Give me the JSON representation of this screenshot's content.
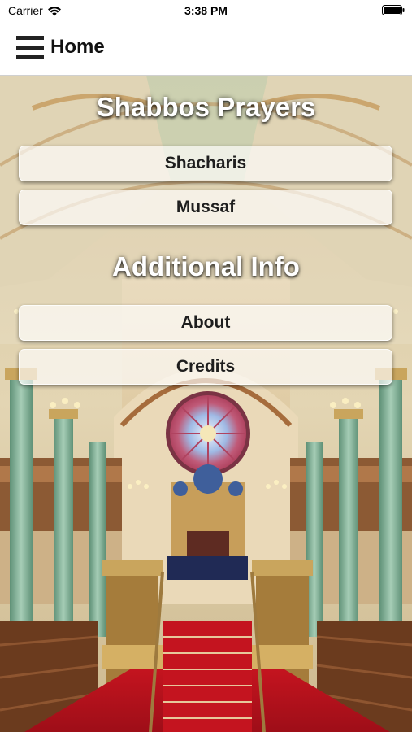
{
  "status_bar": {
    "carrier": "Carrier",
    "time": "3:38 PM",
    "wifi_icon": "wifi-icon",
    "battery_icon": "battery-icon"
  },
  "nav": {
    "title": "Home",
    "menu_icon": "hamburger-menu-icon"
  },
  "sections": {
    "prayers": {
      "title": "Shabbos Prayers",
      "items": [
        {
          "label": "Shacharis"
        },
        {
          "label": "Mussaf"
        }
      ]
    },
    "info": {
      "title": "Additional Info",
      "items": [
        {
          "label": "About"
        },
        {
          "label": "Credits"
        }
      ]
    }
  },
  "background": {
    "description_icon": "synagogue-interior-image"
  },
  "colors": {
    "button_bg": "#ffffffa8",
    "heading_text": "#ffffff",
    "carpet": "#c4141f",
    "columns": "#7fae94"
  }
}
